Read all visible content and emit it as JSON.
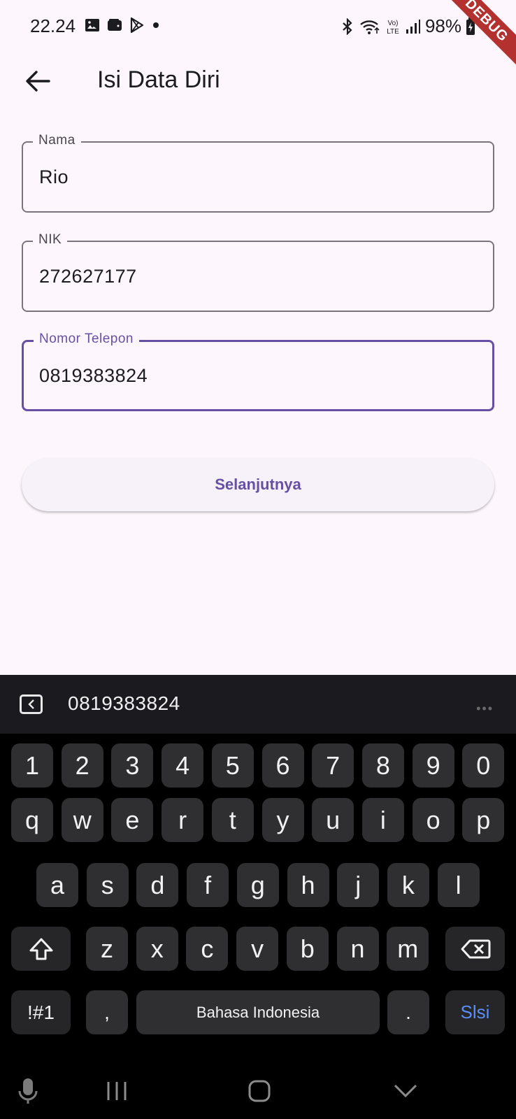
{
  "status_bar": {
    "time": "22.24",
    "battery": "98%",
    "debug_banner": "DEBUG"
  },
  "app_bar": {
    "title": "Isi Data Diri"
  },
  "form": {
    "name": {
      "label": "Nama",
      "value": "Rio"
    },
    "nik": {
      "label": "NIK",
      "value": "272627177"
    },
    "phone": {
      "label": "Nomor Telepon",
      "value": "0819383824"
    },
    "next_button": "Selanjutnya"
  },
  "keyboard": {
    "suggestion": "0819383824",
    "more": "•••",
    "number_row": [
      "1",
      "2",
      "3",
      "4",
      "5",
      "6",
      "7",
      "8",
      "9",
      "0"
    ],
    "row1": [
      "q",
      "w",
      "e",
      "r",
      "t",
      "y",
      "u",
      "i",
      "o",
      "p"
    ],
    "row2": [
      "a",
      "s",
      "d",
      "f",
      "g",
      "h",
      "j",
      "k",
      "l"
    ],
    "row3": [
      "z",
      "x",
      "c",
      "v",
      "b",
      "n",
      "m"
    ],
    "symbols_key": "!#1",
    "comma_key": ",",
    "space_key": "Bahasa Indonesia",
    "period_key": ".",
    "enter_key": "Slsi"
  },
  "colors": {
    "accent": "#6750a4",
    "background": "#fdf7fd",
    "keyboard_bg": "#000000",
    "key_bg": "#2f2f31",
    "enter_text": "#5b8ef7"
  }
}
